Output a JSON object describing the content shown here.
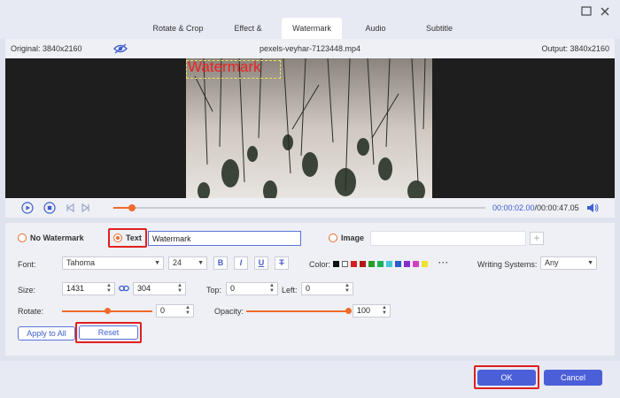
{
  "tabs": [
    "Rotate & Crop",
    "Effect & Filter",
    "Watermark",
    "Audio",
    "Subtitle"
  ],
  "active_tab": "Watermark",
  "preview": {
    "original": "Original: 3840x2160",
    "filename": "pexels-veyhar-7123448.mp4",
    "output": "Output: 3840x2160",
    "watermark_text": "Watermark"
  },
  "playback": {
    "current_time": "00:00:02.00",
    "total_time": "/00:00:47.05",
    "progress": 0.05
  },
  "watermark": {
    "no_watermark_label": "No Watermark",
    "text_label": "Text",
    "text_value": "Watermark",
    "image_label": "Image",
    "image_value": "",
    "selected": "text"
  },
  "font": {
    "label": "Font:",
    "family": "Tahoma",
    "size": "24",
    "bold": "B",
    "italic": "I",
    "underline": "U",
    "strike": "T",
    "color_label": "Color:",
    "swatches": [
      "#111111",
      "#ffffff",
      "#d42020",
      "#b01818",
      "#2a9a2a",
      "#1fb05a",
      "#40c8d8",
      "#2a5fd0",
      "#8a2ad0",
      "#d040c0",
      "#f0e030"
    ],
    "more": "···",
    "writing_label": "Writing Systems:",
    "writing_value": "Any"
  },
  "size": {
    "label": "Size:",
    "width": "1431",
    "height": "304",
    "top_label": "Top:",
    "top": "0",
    "left_label": "Left:",
    "left": "0"
  },
  "rotate": {
    "label": "Rotate:",
    "value": "0",
    "level": 0.5,
    "opacity_label": "Opacity:",
    "opacity_value": "100",
    "opacity_level": 1.0
  },
  "buttons": {
    "apply_all": "Apply to All",
    "reset": "Reset",
    "ok": "OK",
    "cancel": "Cancel"
  },
  "colors": {
    "accent": "#f06a2c",
    "primary": "#4a5fd8",
    "highlight": "#e02020"
  }
}
